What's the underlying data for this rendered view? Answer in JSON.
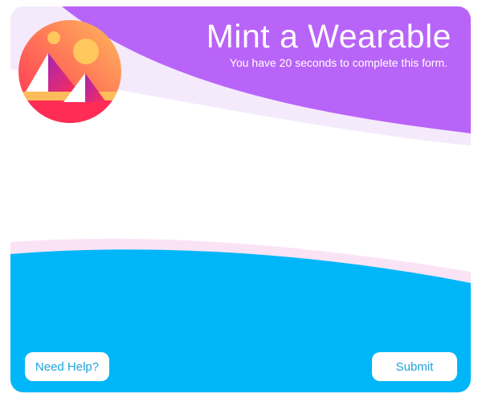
{
  "form": {
    "title": "Mint a Wearable",
    "subtitle": "You have 20 seconds to complete this form.",
    "help_label": "Need Help?",
    "submit_label": "Submit"
  },
  "colors": {
    "header_wave": "#b964f8",
    "footer_wave": "#00b6f8",
    "button_text": "#1ea5dc",
    "logo_gradient_top": "#ff5d58",
    "logo_gradient_bottom": "#ffc75c"
  },
  "icons": {
    "logo": "decentraland-logo-icon"
  }
}
